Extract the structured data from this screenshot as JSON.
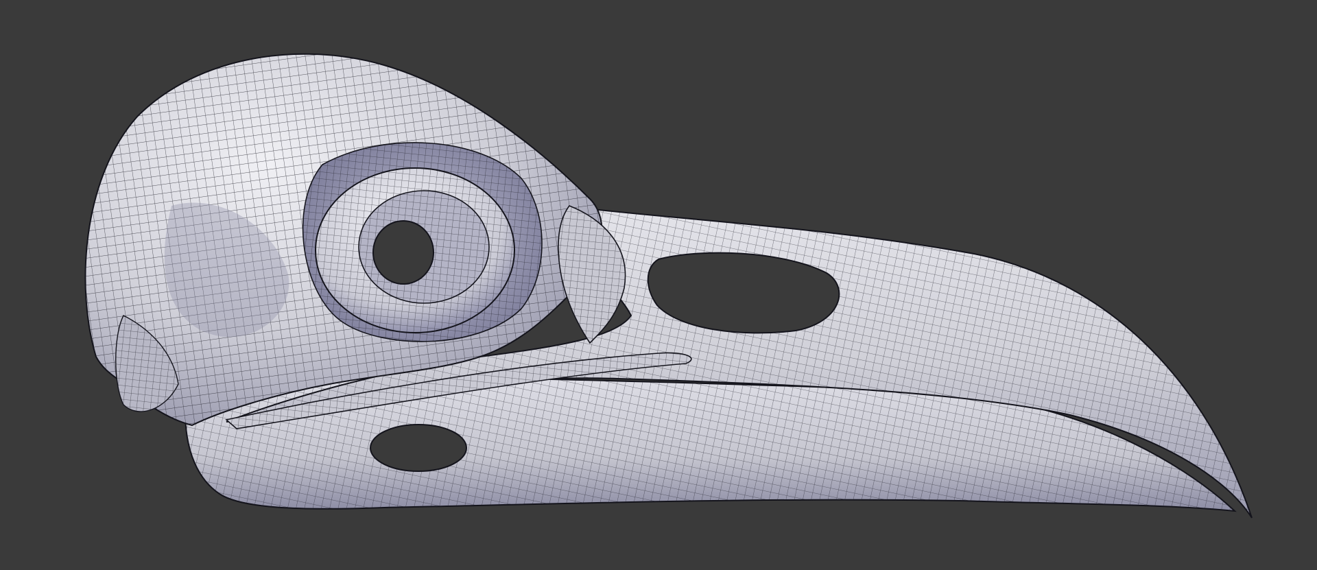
{
  "viewport": {
    "background_color": "#3a3a3a"
  },
  "model": {
    "subject": "bird-skull",
    "render_style": "wireframe-over-shaded",
    "surface_color": "#d4d4dc",
    "shadow_color": "#8a8aa3",
    "wire_color": "#1e1e28"
  }
}
